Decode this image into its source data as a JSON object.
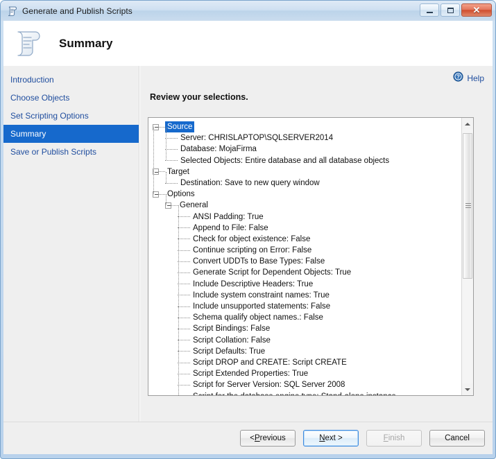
{
  "window": {
    "title": "Generate and Publish Scripts",
    "icon": "script-scroll-icon",
    "caption_buttons": {
      "minimize": "minimize-icon",
      "maximize": "maximize-icon",
      "close": "✕"
    }
  },
  "header": {
    "title": "Summary",
    "icon": "script-scroll-icon"
  },
  "sidebar": {
    "items": [
      {
        "label": "Introduction",
        "selected": false
      },
      {
        "label": "Choose Objects",
        "selected": false
      },
      {
        "label": "Set Scripting Options",
        "selected": false
      },
      {
        "label": "Summary",
        "selected": true
      },
      {
        "label": "Save or Publish Scripts",
        "selected": false
      }
    ]
  },
  "content": {
    "help_label": "Help",
    "help_icon": "help-question-icon",
    "review_heading": "Review your selections."
  },
  "tree": {
    "nodes": [
      {
        "level": 0,
        "type": "branch",
        "label": "Source",
        "selected": true
      },
      {
        "level": 1,
        "type": "leaf",
        "label": "Server: CHRISLAPTOP\\SQLSERVER2014",
        "selected": false
      },
      {
        "level": 1,
        "type": "leaf",
        "label": "Database: MojaFirma",
        "selected": false
      },
      {
        "level": 1,
        "type": "leaf",
        "label": "Selected Objects: Entire database and all database objects",
        "selected": false
      },
      {
        "level": 0,
        "type": "branch",
        "label": "Target",
        "selected": false
      },
      {
        "level": 1,
        "type": "leaf",
        "label": "Destination: Save to new query window",
        "selected": false
      },
      {
        "level": 0,
        "type": "branch",
        "label": "Options",
        "selected": false
      },
      {
        "level": 1,
        "type": "branch",
        "label": "General",
        "selected": false
      },
      {
        "level": 2,
        "type": "leaf",
        "label": "ANSI Padding: True",
        "selected": false
      },
      {
        "level": 2,
        "type": "leaf",
        "label": "Append to File: False",
        "selected": false
      },
      {
        "level": 2,
        "type": "leaf",
        "label": "Check for object existence: False",
        "selected": false
      },
      {
        "level": 2,
        "type": "leaf",
        "label": "Continue scripting on Error: False",
        "selected": false
      },
      {
        "level": 2,
        "type": "leaf",
        "label": "Convert UDDTs to Base Types: False",
        "selected": false
      },
      {
        "level": 2,
        "type": "leaf",
        "label": "Generate Script for Dependent Objects: True",
        "selected": false
      },
      {
        "level": 2,
        "type": "leaf",
        "label": "Include Descriptive Headers: True",
        "selected": false
      },
      {
        "level": 2,
        "type": "leaf",
        "label": "Include system constraint names: True",
        "selected": false
      },
      {
        "level": 2,
        "type": "leaf",
        "label": "Include unsupported statements: False",
        "selected": false
      },
      {
        "level": 2,
        "type": "leaf",
        "label": "Schema qualify object names.: False",
        "selected": false
      },
      {
        "level": 2,
        "type": "leaf",
        "label": "Script Bindings: False",
        "selected": false
      },
      {
        "level": 2,
        "type": "leaf",
        "label": "Script Collation: False",
        "selected": false
      },
      {
        "level": 2,
        "type": "leaf",
        "label": "Script Defaults: True",
        "selected": false
      },
      {
        "level": 2,
        "type": "leaf",
        "label": "Script DROP and CREATE: Script CREATE",
        "selected": false
      },
      {
        "level": 2,
        "type": "leaf",
        "label": "Script Extended Properties: True",
        "selected": false
      },
      {
        "level": 2,
        "type": "leaf",
        "label": "Script for Server Version: SQL Server 2008",
        "selected": false
      },
      {
        "level": 2,
        "type": "leaf",
        "label": "Script for the database engine type: Stand-alone instance",
        "selected": false
      }
    ]
  },
  "scrollbar": {
    "up_arrow": "scroll-up-icon",
    "down_arrow": "scroll-down-icon",
    "thumb": "scrollbar-thumb"
  },
  "footer": {
    "buttons": [
      {
        "name": "previous",
        "prefix": "< ",
        "accel": "P",
        "rest": "revious",
        "state": "enabled"
      },
      {
        "name": "next",
        "prefix": "",
        "accel": "N",
        "rest": "ext >",
        "state": "default"
      },
      {
        "name": "finish",
        "prefix": "",
        "accel": "F",
        "rest": "inish",
        "state": "disabled"
      },
      {
        "name": "cancel",
        "prefix": "",
        "accel": "",
        "rest": "Cancel",
        "state": "enabled"
      }
    ]
  },
  "colors": {
    "accent_blue": "#1669cc",
    "link_blue": "#1f4d9e",
    "panel_gray": "#efefef",
    "close_red": "#cf4b2c"
  }
}
